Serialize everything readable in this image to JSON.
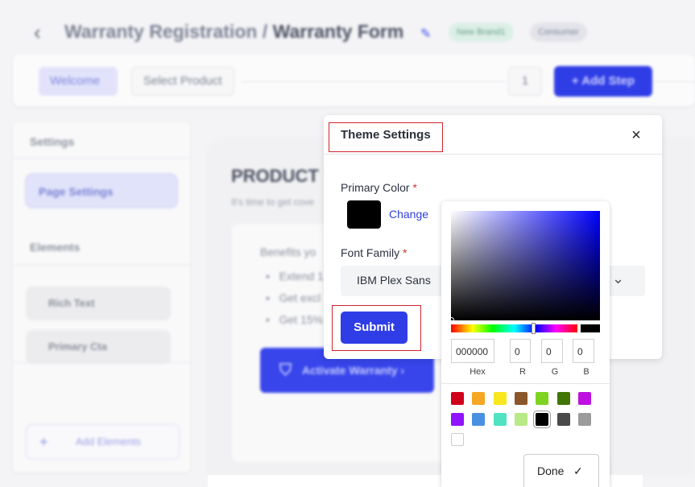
{
  "header": {
    "back_icon": "chevron-left-icon",
    "breadcrumb_parent": "Warranty Registration /",
    "breadcrumb_current": "Warranty Form",
    "edit_icon": "pencil-icon",
    "badges": [
      "New Brand1",
      "Consumer"
    ]
  },
  "steps": {
    "items": [
      "Welcome",
      "Select Product"
    ],
    "count": "1",
    "add_step": "+ Add Step"
  },
  "sidebar": {
    "settings_heading": "Settings",
    "page_settings": "Page Settings",
    "elements_heading": "Elements",
    "elements": [
      "Rich Text",
      "Primary Cta"
    ],
    "add_elements": "Add Elements",
    "add_icon": "plus-icon"
  },
  "main": {
    "title": "PRODUCT",
    "subtitle": "It's time to get cove",
    "benefits_heading": "Benefits yo",
    "benefits": [
      "Extend 1",
      "Get excl",
      "Get 15%"
    ],
    "activate_label": "Activate Warranty",
    "activate_icon": "shield-check-icon"
  },
  "modal": {
    "title": "Theme Settings",
    "close_icon": "close-icon",
    "primary_color_label": "Primary Color",
    "required_mark": "*",
    "change_link": "Change",
    "primary_color_value": "#000000",
    "font_family_label": "Font Family",
    "font_family_value": "IBM Plex Sans",
    "submit": "Submit"
  },
  "color_picker": {
    "hex": "000000",
    "r": "0",
    "g": "0",
    "b": "0",
    "labels": [
      "Hex",
      "R",
      "G",
      "B"
    ],
    "swatches": [
      "#d0021b",
      "#f5a623",
      "#f8e71c",
      "#8b572a",
      "#7ed321",
      "#417505",
      "#bd10e0",
      "#9013fe",
      "#4a90e2",
      "#50e3c2",
      "#b8e986",
      "#000000",
      "#4a4a4a",
      "#9b9b9b",
      "#ffffff"
    ],
    "done": "Done",
    "done_icon": "check-icon"
  },
  "colors": {
    "accent": "#2f3de6",
    "highlight_border": "#d2232a"
  }
}
